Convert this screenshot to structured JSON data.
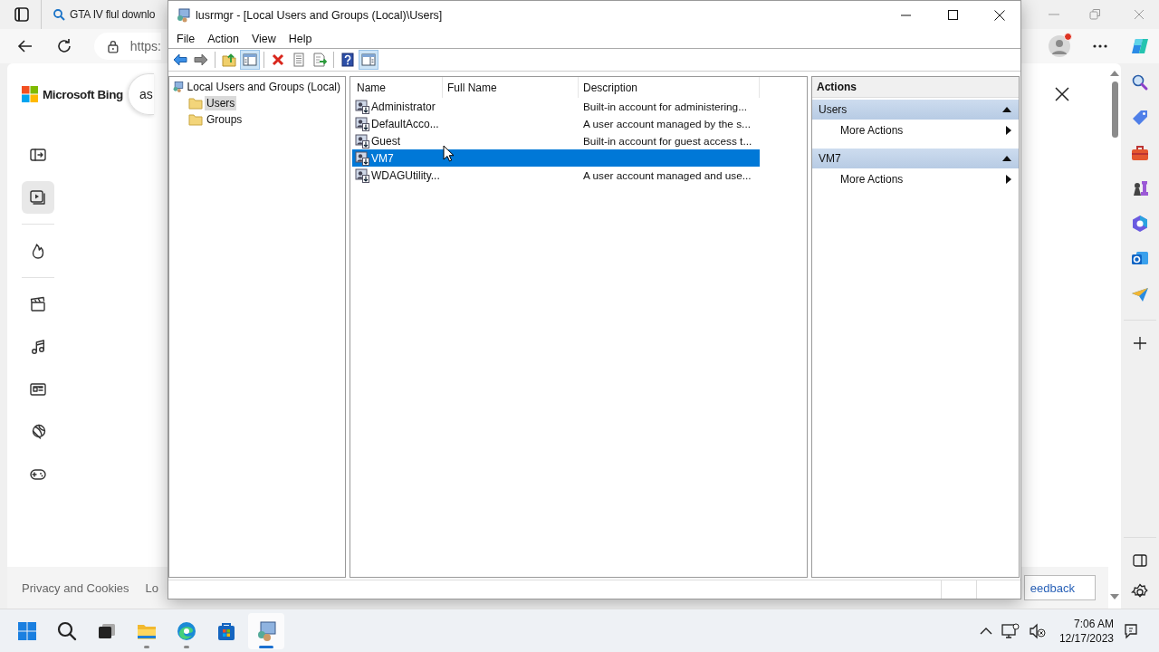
{
  "browser": {
    "tab_title": "GTA IV flul downlo",
    "address": "https:",
    "brand": "Microsoft Bing",
    "search_value": "as",
    "rail_groups": [
      {
        "items": [
          {
            "kind": "panel",
            "selected": false
          },
          {
            "kind": "video",
            "selected": true
          }
        ]
      },
      {
        "items": [
          {
            "kind": "flame",
            "selected": false
          }
        ]
      },
      {
        "items": [
          {
            "kind": "clapper",
            "selected": false
          },
          {
            "kind": "music",
            "selected": false
          },
          {
            "kind": "news",
            "selected": false
          },
          {
            "kind": "ball",
            "selected": false
          },
          {
            "kind": "gamepad",
            "selected": false
          }
        ]
      }
    ],
    "footer_links": [
      "Privacy and Cookies",
      "Lo"
    ],
    "feedback_button": "eedback"
  },
  "window": {
    "title": "lusrmgr - [Local Users and Groups (Local)\\Users]",
    "menu": [
      "File",
      "Action",
      "View",
      "Help"
    ],
    "toolbar_groups": [
      [
        {
          "kind": "back",
          "pressed": false,
          "disabled": false
        },
        {
          "kind": "forward",
          "pressed": false,
          "disabled": true
        }
      ],
      [
        {
          "kind": "up",
          "pressed": false,
          "disabled": false
        },
        {
          "kind": "tree",
          "pressed": true,
          "disabled": false
        }
      ],
      [
        {
          "kind": "delete",
          "pressed": false,
          "disabled": false
        },
        {
          "kind": "properties",
          "pressed": false,
          "disabled": false
        },
        {
          "kind": "export",
          "pressed": false,
          "disabled": false
        }
      ],
      [
        {
          "kind": "help",
          "pressed": false,
          "disabled": false
        },
        {
          "kind": "action_pane",
          "pressed": true,
          "disabled": false
        }
      ]
    ],
    "tree": {
      "label": "Local Users and Groups (Local)",
      "selected": false,
      "children": [
        {
          "label": "Users",
          "selected": true
        },
        {
          "label": "Groups",
          "selected": false
        }
      ]
    },
    "list": {
      "columns": [
        "Name",
        "Full Name",
        "Description"
      ],
      "rows": [
        {
          "name": "Administrator",
          "description": "Built-in account for administering...",
          "selected": false
        },
        {
          "name": "DefaultAcco...",
          "description": "A user account managed by the s...",
          "selected": false
        },
        {
          "name": "Guest",
          "description": "Built-in account for guest access t...",
          "selected": false
        },
        {
          "name": "VM7",
          "selected": true
        },
        {
          "name": "WDAGUtility...",
          "description": "A user account managed and use...",
          "selected": false
        }
      ]
    },
    "actions": {
      "title": "Actions",
      "sections": [
        {
          "title": "Users",
          "items": [
            "More Actions"
          ]
        },
        {
          "title": "VM7",
          "items": [
            "More Actions"
          ]
        }
      ]
    }
  },
  "taskbar": {
    "apps": [
      {
        "kind": "start",
        "running": false,
        "active": false
      },
      {
        "kind": "search",
        "running": false,
        "active": false
      },
      {
        "kind": "task_view",
        "running": false,
        "active": false
      },
      {
        "kind": "explorer",
        "running": true,
        "active": false
      },
      {
        "kind": "browser",
        "running": true,
        "active": false
      },
      {
        "kind": "store",
        "running": false,
        "active": false
      },
      {
        "kind": "console",
        "running": true,
        "active": true
      }
    ],
    "time": "7:06 AM",
    "date": "12/17/2023"
  }
}
